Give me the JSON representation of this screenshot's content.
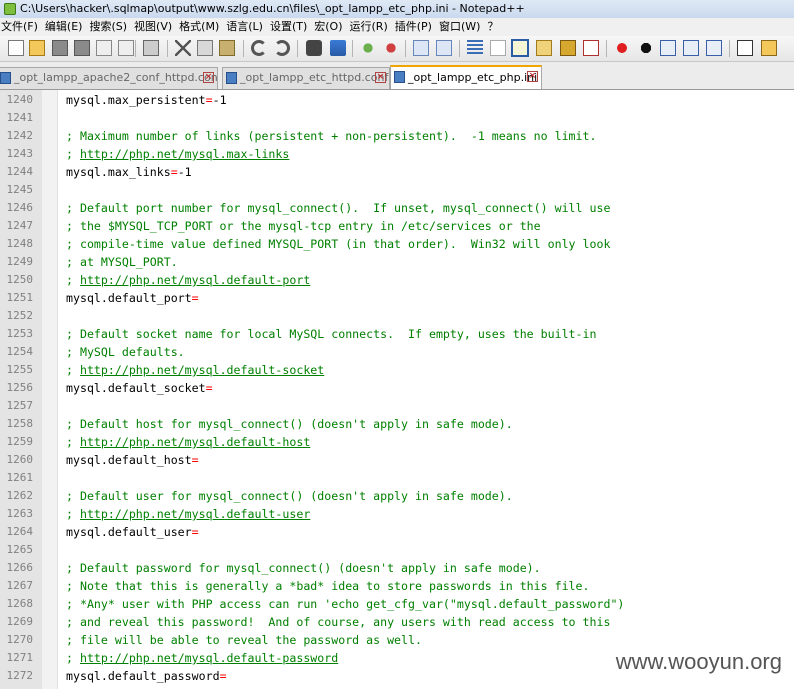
{
  "window": {
    "title": "C:\\Users\\hacker\\.sqlmap\\output\\www.szlg.edu.cn\\files\\_opt_lampp_etc_php.ini - Notepad++"
  },
  "menu": [
    "文件(F)",
    "编辑(E)",
    "搜索(S)",
    "视图(V)",
    "格式(M)",
    "语言(L)",
    "设置(T)",
    "宏(O)",
    "运行(R)",
    "插件(P)",
    "窗口(W)",
    "？"
  ],
  "toolbar_icons": [
    "new-file-icon",
    "open-file-icon",
    "save-icon",
    "save-all-icon",
    "close-icon",
    "close-all-icon",
    "print-icon",
    "cut-icon",
    "copy-icon",
    "paste-icon",
    "undo-icon",
    "redo-icon",
    "find-icon",
    "replace-icon",
    "zoom-in-icon",
    "zoom-out-icon",
    "sync-vertical-icon",
    "sync-horizontal-icon",
    "word-wrap-icon",
    "show-all-chars-icon",
    "indent-guide-icon",
    "user-lang-icon",
    "doc-map-icon",
    "function-list-icon",
    "record-macro-icon",
    "stop-macro-icon",
    "play-macro-icon",
    "run-macro-multiple-icon",
    "save-macro-icon",
    "spell-check-icon",
    "plugin-icon"
  ],
  "tabs": [
    {
      "label": "_opt_lampp_apache2_conf_httpd.conf",
      "active": false
    },
    {
      "label": "_opt_lampp_etc_httpd.conf",
      "active": false
    },
    {
      "label": "_opt_lampp_etc_php.ini",
      "active": true
    }
  ],
  "lines": [
    {
      "num": "1240",
      "type": "kv",
      "key": "mysql.max_persistent",
      "val": "-1"
    },
    {
      "num": "1241",
      "type": "blank",
      "text": ""
    },
    {
      "num": "1242",
      "type": "comment",
      "text": "; Maximum number of links (persistent + non-persistent).  -1 means no limit."
    },
    {
      "num": "1243",
      "type": "url",
      "prefix": "; ",
      "url": "http://php.net/mysql.max-links"
    },
    {
      "num": "1244",
      "type": "kv",
      "key": "mysql.max_links",
      "val": "-1"
    },
    {
      "num": "1245",
      "type": "blank",
      "text": ""
    },
    {
      "num": "1246",
      "type": "comment",
      "text": "; Default port number for mysql_connect().  If unset, mysql_connect() will use"
    },
    {
      "num": "1247",
      "type": "comment",
      "text": "; the $MYSQL_TCP_PORT or the mysql-tcp entry in /etc/services or the"
    },
    {
      "num": "1248",
      "type": "comment",
      "text": "; compile-time value defined MYSQL_PORT (in that order).  Win32 will only look"
    },
    {
      "num": "1249",
      "type": "comment",
      "text": "; at MYSQL_PORT."
    },
    {
      "num": "1250",
      "type": "url",
      "prefix": "; ",
      "url": "http://php.net/mysql.default-port"
    },
    {
      "num": "1251",
      "type": "kv",
      "key": "mysql.default_port",
      "val": ""
    },
    {
      "num": "1252",
      "type": "blank",
      "text": ""
    },
    {
      "num": "1253",
      "type": "comment",
      "text": "; Default socket name for local MySQL connects.  If empty, uses the built-in"
    },
    {
      "num": "1254",
      "type": "comment",
      "text": "; MySQL defaults."
    },
    {
      "num": "1255",
      "type": "url",
      "prefix": "; ",
      "url": "http://php.net/mysql.default-socket"
    },
    {
      "num": "1256",
      "type": "kv",
      "key": "mysql.default_socket",
      "val": ""
    },
    {
      "num": "1257",
      "type": "blank",
      "text": ""
    },
    {
      "num": "1258",
      "type": "comment",
      "text": "; Default host for mysql_connect() (doesn't apply in safe mode)."
    },
    {
      "num": "1259",
      "type": "url",
      "prefix": "; ",
      "url": "http://php.net/mysql.default-host"
    },
    {
      "num": "1260",
      "type": "kv",
      "key": "mysql.default_host",
      "val": ""
    },
    {
      "num": "1261",
      "type": "blank",
      "text": ""
    },
    {
      "num": "1262",
      "type": "comment",
      "text": "; Default user for mysql_connect() (doesn't apply in safe mode)."
    },
    {
      "num": "1263",
      "type": "url",
      "prefix": "; ",
      "url": "http://php.net/mysql.default-user"
    },
    {
      "num": "1264",
      "type": "kv",
      "key": "mysql.default_user",
      "val": ""
    },
    {
      "num": "1265",
      "type": "blank",
      "text": ""
    },
    {
      "num": "1266",
      "type": "comment",
      "text": "; Default password for mysql_connect() (doesn't apply in safe mode)."
    },
    {
      "num": "1267",
      "type": "comment",
      "text": "; Note that this is generally a *bad* idea to store passwords in this file."
    },
    {
      "num": "1268",
      "type": "comment",
      "text": "; *Any* user with PHP access can run 'echo get_cfg_var(\"mysql.default_password\")"
    },
    {
      "num": "1269",
      "type": "comment",
      "text": "; and reveal this password!  And of course, any users with read access to this"
    },
    {
      "num": "1270",
      "type": "comment",
      "text": "; file will be able to reveal the password as well."
    },
    {
      "num": "1271",
      "type": "url",
      "prefix": "; ",
      "url": "http://php.net/mysql.default-password"
    },
    {
      "num": "1272",
      "type": "kv",
      "key": "mysql.default_password",
      "val": ""
    }
  ],
  "watermark": "www.wooyun.org"
}
